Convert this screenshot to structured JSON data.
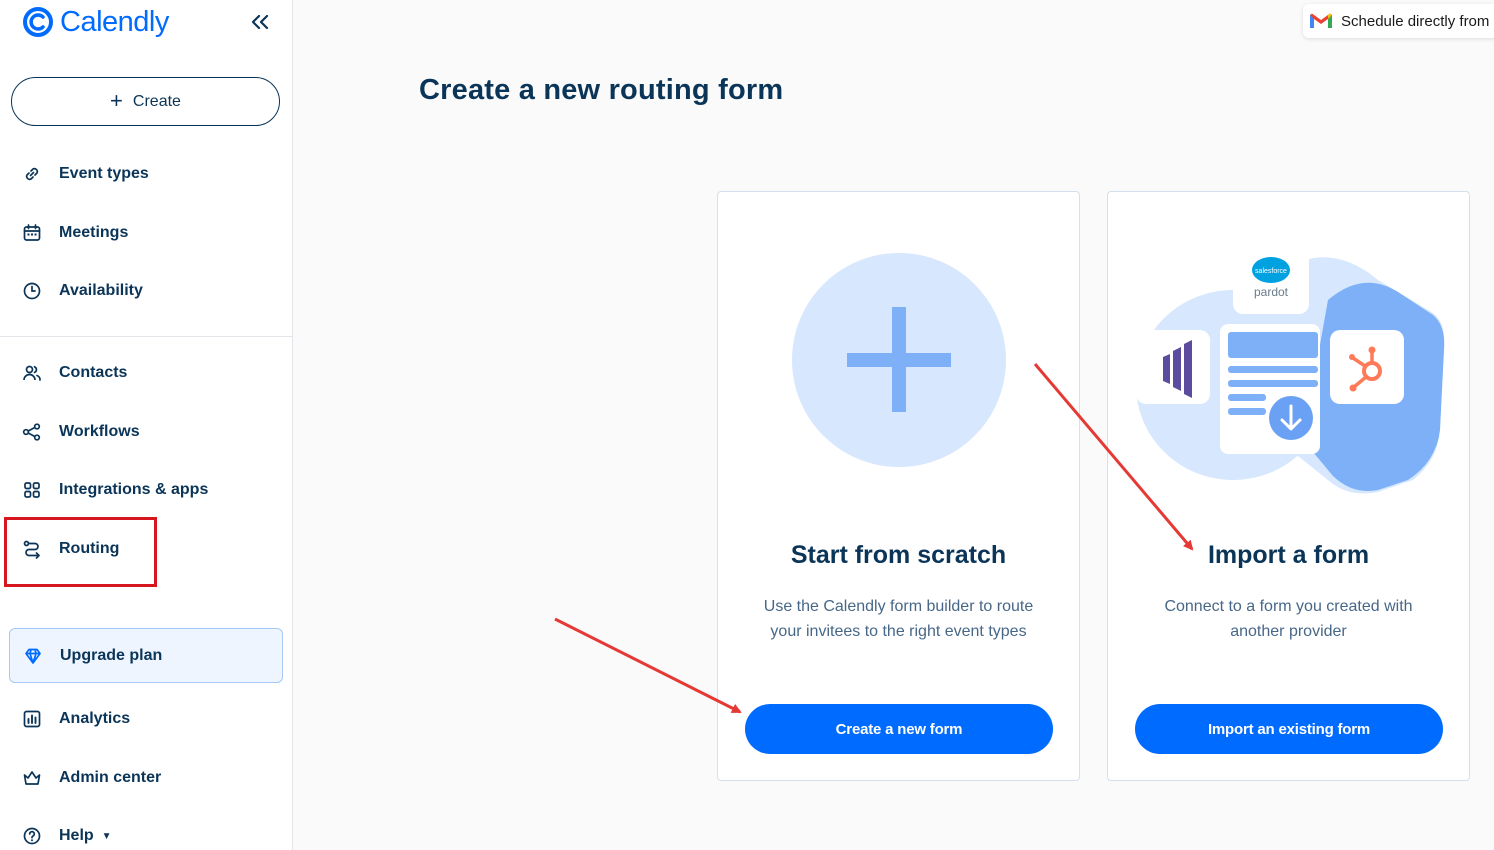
{
  "app": {
    "name": "Calendly",
    "brand_color": "#006bff",
    "text_color": "#0b3558"
  },
  "sidebar": {
    "collapse_icon": "double-chevron-left-icon",
    "create_label": "Create",
    "items": [
      {
        "label": "Event types",
        "icon": "link-icon"
      },
      {
        "label": "Meetings",
        "icon": "calendar-icon"
      },
      {
        "label": "Availability",
        "icon": "clock-icon"
      },
      {
        "label": "Contacts",
        "icon": "people-icon"
      },
      {
        "label": "Workflows",
        "icon": "workflow-icon"
      },
      {
        "label": "Integrations & apps",
        "icon": "grid-icon"
      },
      {
        "label": "Routing",
        "icon": "routing-icon"
      },
      {
        "label": "Upgrade plan",
        "icon": "diamond-icon"
      },
      {
        "label": "Analytics",
        "icon": "bar-chart-icon"
      },
      {
        "label": "Admin center",
        "icon": "crown-icon"
      },
      {
        "label": "Help",
        "icon": "question-icon"
      }
    ]
  },
  "banner": {
    "text": "Schedule directly from",
    "icon": "gmail-icon"
  },
  "main": {
    "title": "Create a new routing form",
    "cards": [
      {
        "title": "Start from scratch",
        "description": "Use the Calendly form builder to route your invitees to the right event types",
        "button": "Create a new form",
        "icon": "plus-icon"
      },
      {
        "title": "Import a form",
        "description": "Connect to a form you created with another provider",
        "button": "Import an existing form",
        "illustration": {
          "pardot_top": "salesforce",
          "pardot_bottom": "pardot"
        }
      }
    ]
  },
  "annotations": {
    "highlight_color": "#d6171f",
    "arrow_color": "#e53935"
  }
}
